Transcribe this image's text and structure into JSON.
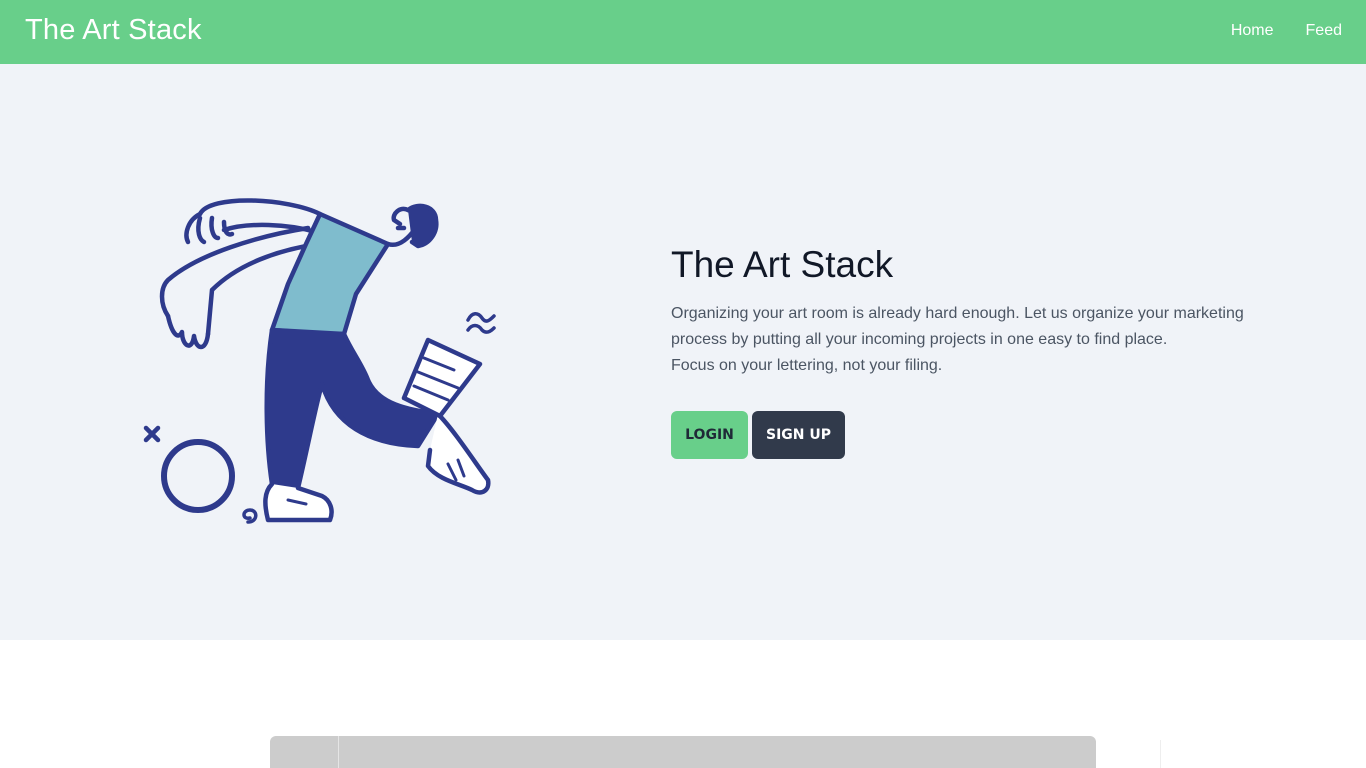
{
  "navbar": {
    "brand": "The Art Stack",
    "links": [
      {
        "label": "Home"
      },
      {
        "label": "Feed"
      }
    ]
  },
  "hero": {
    "title": "The Art Stack",
    "paragraph_1": "Organizing your art room is already hard enough. Let us organize your marketing process by putting all your incoming projects in one easy to find place.",
    "paragraph_2": "Focus on your lettering, not your filing.",
    "login_label": "LOGIN",
    "signup_label": "SIGN UP",
    "illustration_icon": "dancing-artist-illustration"
  },
  "colors": {
    "accent": "#68cf8a",
    "dark": "#313a4b",
    "hero_bg": "#f0f3f8",
    "illustration_stroke": "#2e3a8c",
    "illustration_shirt": "#7fbccd"
  }
}
